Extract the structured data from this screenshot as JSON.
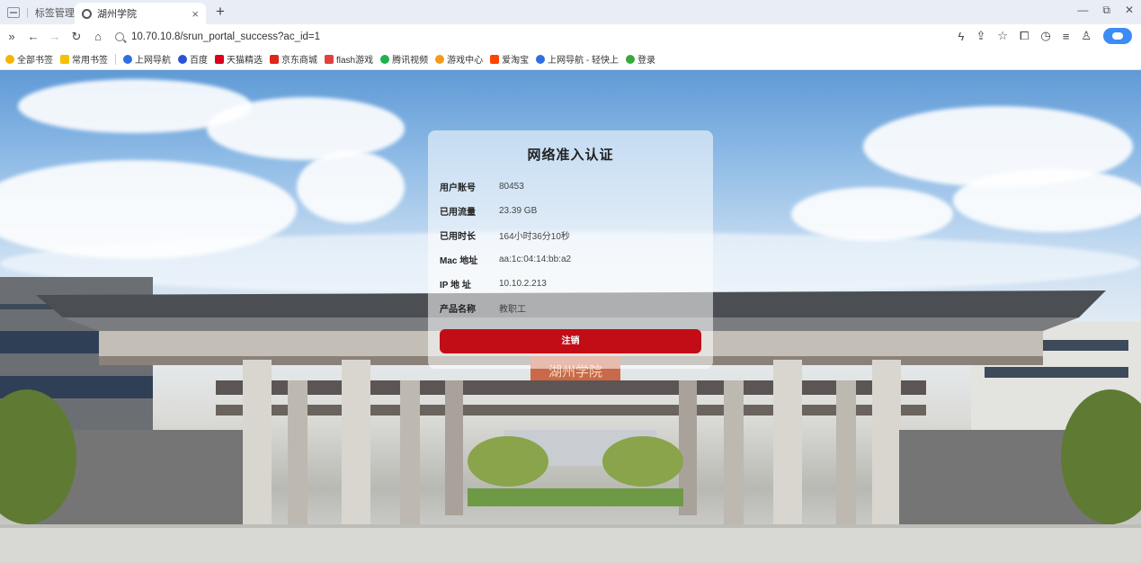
{
  "browser": {
    "tab_group_label": "标签管理",
    "tab_title": "湖州学院",
    "url": "10.70.10.8/srun_portal_success?ac_id=1",
    "bookmarks": [
      "全部书签",
      "常用书签",
      "上网导航",
      "百度",
      "天猫精选",
      "京东商城",
      "flash游戏",
      "腾讯视频",
      "游戏中心",
      "爱淘宝",
      "上网导航 - 轻快上",
      "登录"
    ]
  },
  "page": {
    "gate_sign": "湖州学院",
    "panel": {
      "title": "网络准入认证",
      "rows": [
        {
          "label": "用户账号",
          "value": "80453"
        },
        {
          "label": "已用流量",
          "value": "23.39 GB"
        },
        {
          "label": "已用时长",
          "value": "164小时36分10秒"
        },
        {
          "label": "Mac 地址",
          "value": "aa:1c:04:14:bb:a2"
        },
        {
          "label": "IP 地 址",
          "value": "10.10.2.213"
        },
        {
          "label": "产品名称",
          "value": "教职工"
        }
      ],
      "logout_label": "注销"
    }
  },
  "colors": {
    "accent": "#c20d16",
    "toolbar_bg": "#e9edf5"
  }
}
